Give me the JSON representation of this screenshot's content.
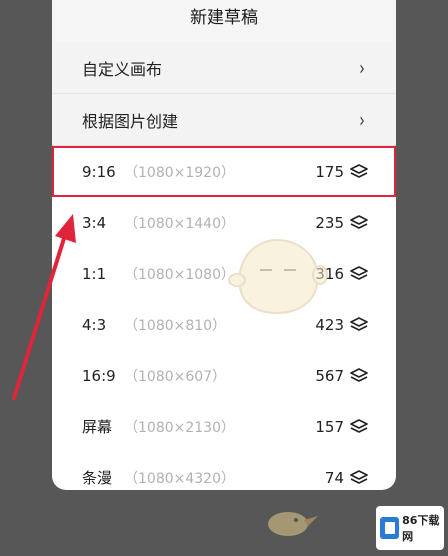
{
  "sheet": {
    "title": "新建草稿",
    "menu": [
      {
        "label": "自定义画布",
        "chevron": "›"
      },
      {
        "label": "根据图片创建",
        "chevron": "›"
      }
    ]
  },
  "sizes": [
    {
      "ratio": "9:16",
      "dims": "（1080×1920）",
      "count": "175",
      "selected": true
    },
    {
      "ratio": "3:4",
      "dims": "（1080×1440）",
      "count": "235",
      "selected": false
    },
    {
      "ratio": "1:1",
      "dims": "（1080×1080）",
      "count": "316",
      "selected": false
    },
    {
      "ratio": "4:3",
      "dims": "（1080×810）",
      "count": "423",
      "selected": false
    },
    {
      "ratio": "16:9",
      "dims": "（1080×607）",
      "count": "567",
      "selected": false
    },
    {
      "ratio": "屏幕",
      "dims": "（1080×2130）",
      "count": "157",
      "selected": false
    },
    {
      "ratio": "条漫",
      "dims": "（1080×4320）",
      "count": "74",
      "selected": false
    }
  ],
  "watermark": {
    "badge_text": "86下载网"
  },
  "colors": {
    "highlight": "#e0243a",
    "backdrop": "#575757",
    "dims_text": "#b2b2b2",
    "logo": "#2a7bd4"
  },
  "icons": {
    "menu_chevron": "chevron-right-icon",
    "layer_count": "layers-icon"
  }
}
